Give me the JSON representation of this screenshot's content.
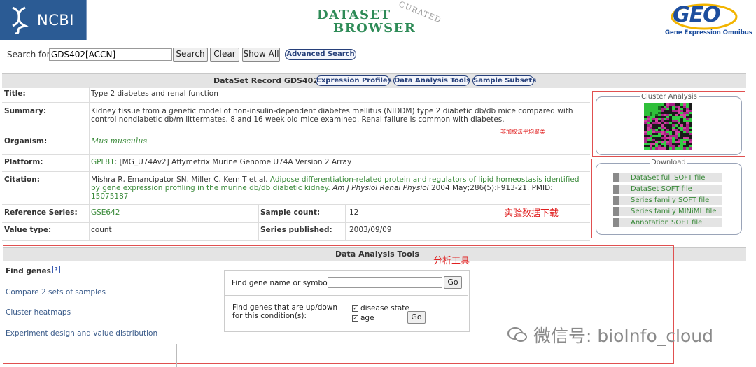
{
  "header": {
    "ncbi_logo_text": "NCBI",
    "browser_logo": {
      "line1": "DataSet",
      "line2": "Browser",
      "corner": "CURATED"
    },
    "geo_logo": {
      "mark": "GEO",
      "subtitle": "Gene Expression Omnibus"
    }
  },
  "search": {
    "label": "Search for",
    "value": "GDS402[ACCN]",
    "search_btn": "Search",
    "clear_btn": "Clear",
    "show_all_btn": "Show All",
    "advanced_btn": "Advanced Search"
  },
  "record": {
    "title": "DataSet Record GDS402:",
    "links": [
      "Expression Profiles",
      "Data Analysis Tools",
      "Sample Subsets"
    ],
    "fields": {
      "title_label": "Title:",
      "title_value": "Type 2 diabetes and renal function",
      "summary_label": "Summary:",
      "summary_value": "Kidney tissue from a genetic model of non-insulin-dependent diabetes mellitus (NIDDM) type 2 diabetic db/db mice compared with control nondiabetic db/m littermates. 8 and 16 week old mice examined. Renal failure is common with diabetes.",
      "organism_label": "Organism:",
      "organism_value": "Mus musculus",
      "platform_label": "Platform:",
      "platform_link": "GPL81",
      "platform_value": ": [MG_U74Av2] Affymetrix Murine Genome U74A Version 2 Array",
      "citation_label": "Citation:",
      "citation_authors": "Mishra R, Emancipator SN, Miller C, Kern T et al.",
      "citation_title": "Adipose differentiation-related protein and regulators of lipid homeostasis identified by gene expression profiling in the murine db/db diabetic kidney.",
      "citation_journal": "Am J Physiol Renal Physiol",
      "citation_ref": "2004 May;286(5):F913-21. PMID:",
      "citation_pmid": "15075187",
      "ref_series_label": "Reference Series:",
      "ref_series_value": "GSE642",
      "sample_count_label": "Sample count:",
      "sample_count_value": "12",
      "value_type_label": "Value type:",
      "value_type_value": "count",
      "series_published_label": "Series published:",
      "series_published_value": "2003/09/09"
    }
  },
  "cluster": {
    "title": "Cluster Analysis"
  },
  "download": {
    "title": "Download",
    "items": [
      "DataSet full SOFT file",
      "DataSet SOFT file",
      "Series family SOFT file",
      "Series family MINiML file",
      "Annotation SOFT file"
    ]
  },
  "annotations": {
    "cluster_note": "非加权法平均聚类",
    "download_note": "实验数据下载",
    "tools_note": "分析工具"
  },
  "tools": {
    "title": "Data Analysis Tools",
    "find_genes": "Find genes",
    "help_icon": "?",
    "links": [
      "Compare 2 sets of samples",
      "Cluster heatmaps",
      "Experiment design and value distribution"
    ],
    "find_name_label": "Find gene name or symbol:",
    "go": "Go",
    "updown_label_1": "Find genes that are up/down",
    "updown_label_2": "for this condition(s):",
    "conditions": [
      "disease state",
      "age"
    ]
  },
  "watermark": "微信号: bioInfo_cloud",
  "colors": {
    "ncbi_blue": "#2b5b94",
    "link_green": "#3a8a3a",
    "annotation_red": "#e02020",
    "bar_gray": "#e4e4e4"
  }
}
